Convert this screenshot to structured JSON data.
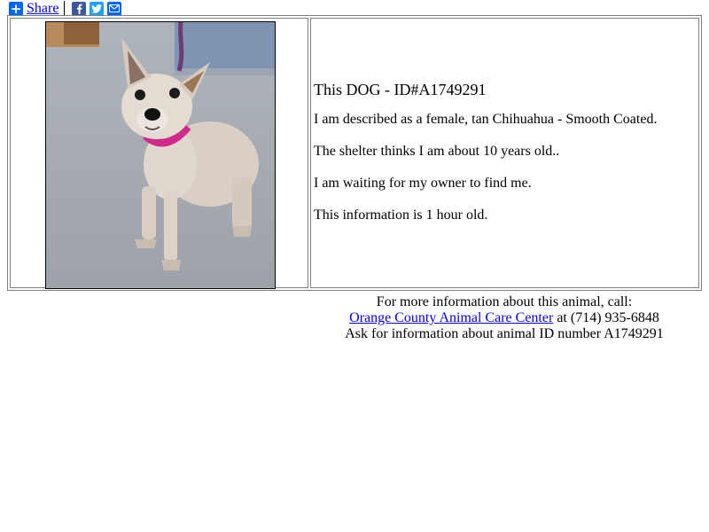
{
  "share": {
    "label": "Share",
    "icons": [
      "share-plus-icon",
      "facebook-icon",
      "twitter-icon",
      "email-icon"
    ]
  },
  "animal": {
    "heading": "This DOG - ID#A1749291",
    "description": "I am described as a female, tan Chihuahua - Smooth Coated.",
    "age": "The shelter thinks I am about 10 years old..",
    "status": "I am waiting for my owner to find me.",
    "freshness": "This information is 1 hour old."
  },
  "contact": {
    "line1": "For more information about this animal, call:",
    "shelter_link": "Orange County Animal Care Center",
    "phone_text": " at (714) 935-6848",
    "line3": "Ask for information about animal ID number A1749291"
  },
  "colors": {
    "link": "#0000ee",
    "share_blue": "#0166ff",
    "facebook": "#3b5998",
    "twitter": "#1da1f2"
  }
}
